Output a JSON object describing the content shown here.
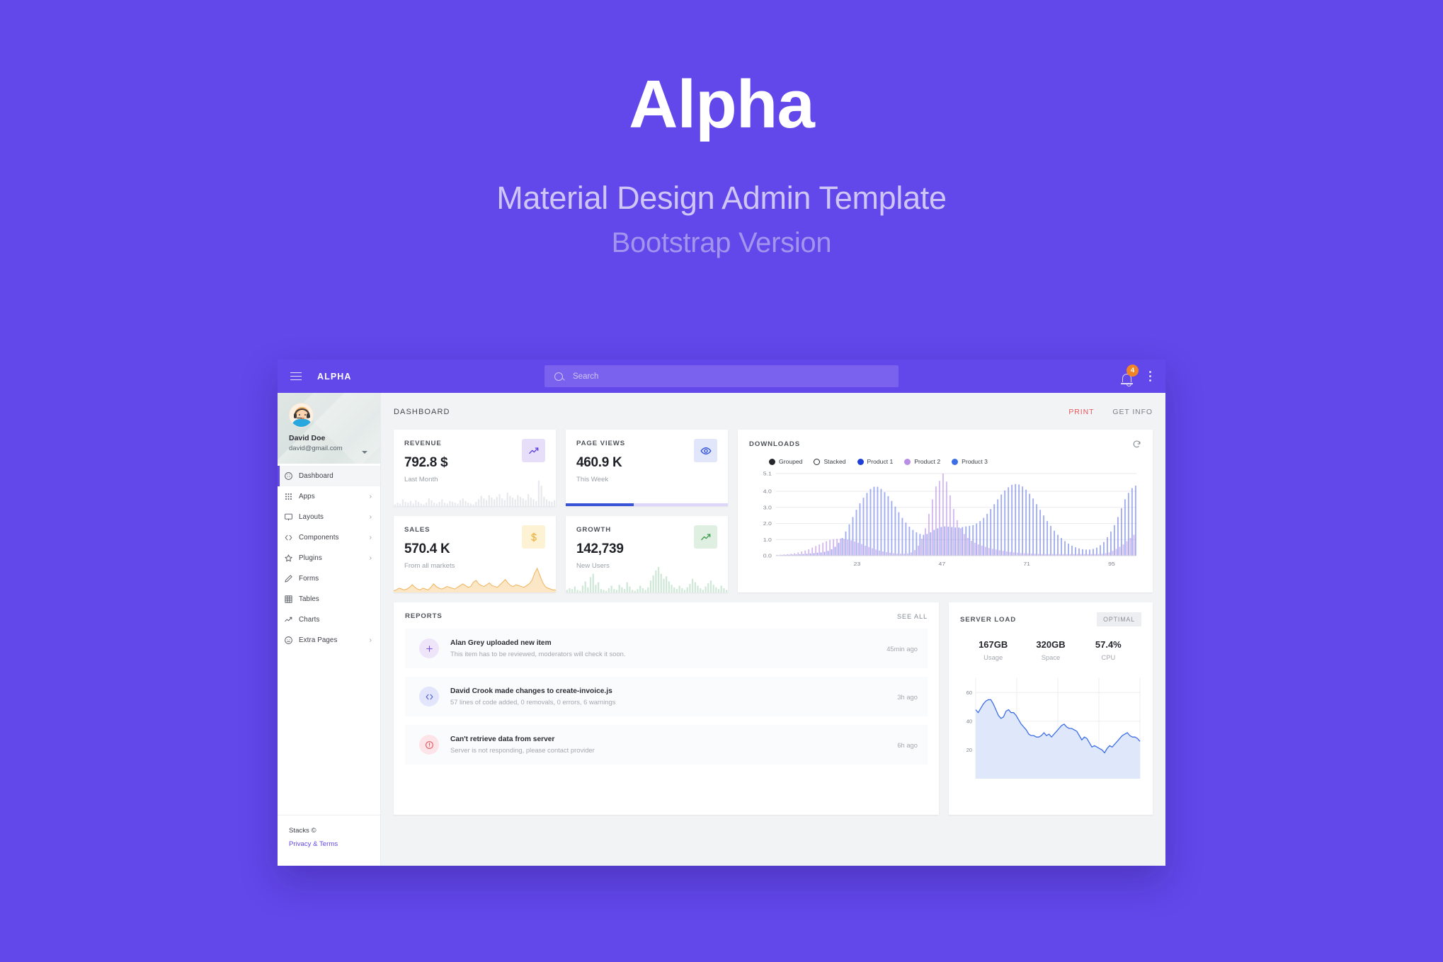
{
  "hero": {
    "title": "Alpha",
    "subtitle": "Material Design Admin Template",
    "subtitle2": "Bootstrap Version"
  },
  "colors": {
    "brand_purple": "#6247ea",
    "accent_blue": "#3853d6",
    "accent_orange": "#f08427",
    "accent_red": "#e2575d",
    "accent_green": "#4caf50",
    "product2_purple": "#b98fe6",
    "product3_blue": "#6b7ce8"
  },
  "topbar": {
    "brand": "ALPHA",
    "menu_icon": "hamburger-icon",
    "search_placeholder": "Search",
    "search_value": "",
    "notification_count": "4",
    "more_icon": "kebab-menu-icon"
  },
  "sidebar": {
    "user": {
      "name": "David Doe",
      "email": "david@gmail.com"
    },
    "items": [
      {
        "label": "Dashboard",
        "icon": "dashboard-icon",
        "chevron": "",
        "active": true
      },
      {
        "label": "Apps",
        "icon": "apps-grid-icon",
        "chevron": "›",
        "active": false
      },
      {
        "label": "Layouts",
        "icon": "monitor-icon",
        "chevron": "›",
        "active": false
      },
      {
        "label": "Components",
        "icon": "code-icon",
        "chevron": "›",
        "active": false
      },
      {
        "label": "Plugins",
        "icon": "star-icon",
        "chevron": "›",
        "active": false
      },
      {
        "label": "Forms",
        "icon": "pencil-icon",
        "chevron": "",
        "active": false
      },
      {
        "label": "Tables",
        "icon": "table-grid-icon",
        "chevron": "",
        "active": false
      },
      {
        "label": "Charts",
        "icon": "trend-line-icon",
        "chevron": "",
        "active": false
      },
      {
        "label": "Extra Pages",
        "icon": "smiley-icon",
        "chevron": "›",
        "active": false
      }
    ],
    "footer": {
      "copyright": "Stacks ©",
      "privacy": "Privacy & Terms"
    }
  },
  "main": {
    "page_title": "DASHBOARD",
    "print_label": "PRINT",
    "get_info_label": "GET INFO"
  },
  "stats": [
    {
      "title": "REVENUE",
      "value": "792.8 $",
      "sub": "Last Month",
      "icon": "trend-up-icon"
    },
    {
      "title": "PAGE VIEWS",
      "value": "460.9 K",
      "sub": "This Week",
      "icon": "eye-icon"
    },
    {
      "title": "SALES",
      "value": "570.4 K",
      "sub": "From all markets",
      "icon": "dollar-icon"
    },
    {
      "title": "GROWTH",
      "value": "142,739",
      "sub": "New Users",
      "icon": "trend-up-icon"
    }
  ],
  "page_views_progress": 42,
  "downloads": {
    "title": "DOWNLOADS",
    "refresh_icon": "refresh-icon",
    "legend": [
      {
        "label": "Grouped",
        "style": "filled-dark"
      },
      {
        "label": "Stacked",
        "style": "hollow"
      },
      {
        "label": "Product 1",
        "style": "filled",
        "color": "#1f3fd6"
      },
      {
        "label": "Product 2",
        "style": "filled",
        "color": "#b98fe6"
      },
      {
        "label": "Product 3",
        "style": "filled",
        "color": "#3d6ee8"
      }
    ]
  },
  "reports": {
    "title": "REPORTS",
    "see_all": "SEE ALL",
    "items": [
      {
        "icon": "plus-icon",
        "title": "Alan Grey uploaded new item",
        "desc": "This item has to be reviewed, moderators will check it soon.",
        "time": "45min ago"
      },
      {
        "icon": "code-icon",
        "title": "David Crook made changes to create-invoice.js",
        "desc": "57 lines of code added, 0 removals, 0 errors, 6 warnings",
        "time": "3h ago"
      },
      {
        "icon": "alert-icon",
        "title": "Can't retrieve data from server",
        "desc": "Server is not responding, please contact provider",
        "time": "6h ago"
      }
    ]
  },
  "server_load": {
    "title": "SERVER LOAD",
    "status": "OPTIMAL",
    "metrics": [
      {
        "value": "167GB",
        "label": "Usage"
      },
      {
        "value": "320GB",
        "label": "Space"
      },
      {
        "value": "57.4%",
        "label": "CPU"
      }
    ]
  },
  "chart_data": [
    {
      "type": "bar",
      "title": "DOWNLOADS",
      "xlabel": "",
      "ylabel": "",
      "ylim": [
        0,
        5.1
      ],
      "yticks": [
        "0.0",
        "1.0",
        "2.0",
        "3.0",
        "4.0",
        "5.1"
      ],
      "xticks": [
        "23",
        "47",
        "71",
        "95"
      ],
      "grid": true,
      "legend": [
        "Grouped",
        "Stacked",
        "Product 1",
        "Product 2",
        "Product 3"
      ],
      "series": [
        {
          "name": "Product 2",
          "color": "#b98fe6",
          "values": [
            0.05,
            0.06,
            0.08,
            0.09,
            0.12,
            0.15,
            0.2,
            0.26,
            0.32,
            0.4,
            0.5,
            0.6,
            0.7,
            0.8,
            0.9,
            0.98,
            1.02,
            1.05,
            1.06,
            1.04,
            1.0,
            0.95,
            0.88,
            0.8,
            0.72,
            0.62,
            0.54,
            0.46,
            0.38,
            0.32,
            0.26,
            0.22,
            0.18,
            0.15,
            0.13,
            0.12,
            0.12,
            0.14,
            0.2,
            0.35,
            0.62,
            1.05,
            1.7,
            2.6,
            3.5,
            4.3,
            4.65,
            5.1,
            4.6,
            3.75,
            2.9,
            2.2,
            1.7,
            1.35,
            1.1,
            0.92,
            0.8,
            0.7,
            0.62,
            0.55,
            0.48,
            0.42,
            0.38,
            0.33,
            0.3,
            0.26,
            0.23,
            0.2,
            0.18,
            0.16,
            0.15,
            0.14,
            0.13,
            0.12,
            0.11,
            0.1,
            0.1,
            0.1,
            0.1,
            0.1,
            0.1,
            0.1,
            0.1,
            0.1,
            0.1,
            0.1,
            0.1,
            0.1,
            0.1,
            0.1,
            0.1,
            0.1,
            0.12,
            0.15,
            0.2,
            0.3,
            0.42,
            0.55,
            0.7,
            0.9,
            1.1,
            1.3
          ]
        },
        {
          "name": "Product 3",
          "color": "#6b7ce8",
          "values": [
            0.03,
            0.04,
            0.05,
            0.06,
            0.07,
            0.08,
            0.09,
            0.1,
            0.12,
            0.14,
            0.16,
            0.18,
            0.2,
            0.24,
            0.3,
            0.4,
            0.55,
            0.8,
            1.1,
            1.5,
            1.95,
            2.4,
            2.85,
            3.25,
            3.6,
            3.9,
            4.15,
            4.28,
            4.28,
            4.15,
            3.95,
            3.7,
            3.4,
            3.05,
            2.7,
            2.35,
            2.05,
            1.8,
            1.6,
            1.45,
            1.35,
            1.3,
            1.35,
            1.45,
            1.6,
            1.7,
            1.78,
            1.82,
            1.8,
            1.78,
            1.75,
            1.75,
            1.78,
            1.82,
            1.85,
            1.9,
            2.0,
            2.15,
            2.35,
            2.6,
            2.9,
            3.2,
            3.5,
            3.8,
            4.05,
            4.25,
            4.4,
            4.45,
            4.42,
            4.3,
            4.1,
            3.85,
            3.55,
            3.2,
            2.85,
            2.5,
            2.15,
            1.85,
            1.55,
            1.3,
            1.1,
            0.9,
            0.75,
            0.62,
            0.52,
            0.45,
            0.4,
            0.38,
            0.38,
            0.42,
            0.5,
            0.65,
            0.85,
            1.15,
            1.5,
            1.9,
            2.4,
            2.95,
            3.5,
            3.9,
            4.2,
            4.35
          ]
        }
      ]
    },
    {
      "type": "area",
      "title": "SERVER LOAD",
      "ylim": [
        0,
        70
      ],
      "yticks": [
        "20",
        "40",
        "60"
      ],
      "grid": true,
      "line_color": "#3d6ee8",
      "fill_color": "#dfe7fb",
      "values": [
        48,
        46,
        49,
        52,
        54,
        55,
        55,
        52,
        48,
        44,
        42,
        43,
        47,
        48,
        46,
        46,
        44,
        41,
        38,
        36,
        34,
        31,
        30,
        30,
        29,
        29,
        30,
        32,
        30,
        31,
        29,
        31,
        33,
        35,
        37,
        38,
        36,
        35,
        35,
        34,
        33,
        30,
        27,
        29,
        28,
        25,
        22,
        23,
        22,
        21,
        20,
        18,
        21,
        23,
        22,
        24,
        26,
        28,
        30,
        31,
        32,
        30,
        29,
        29,
        28,
        26
      ]
    },
    {
      "type": "bar",
      "title": "REVENUE sparkline",
      "color": "#e8e9ec",
      "values": [
        2,
        4,
        3,
        8,
        5,
        4,
        6,
        3,
        7,
        5,
        3,
        2,
        4,
        9,
        7,
        4,
        3,
        5,
        8,
        4,
        3,
        6,
        5,
        4,
        3,
        7,
        9,
        6,
        4,
        3,
        2,
        5,
        8,
        12,
        9,
        7,
        13,
        10,
        8,
        11,
        14,
        9,
        7,
        16,
        12,
        10,
        8,
        13,
        11,
        9,
        7,
        14,
        10,
        8,
        6,
        30,
        24,
        11,
        8,
        6,
        5,
        7
      ]
    },
    {
      "type": "area",
      "title": "SALES sparkline",
      "line_color": "#f0b35a",
      "fill_color": "#fbe6c6",
      "values": [
        2,
        3,
        5,
        4,
        3,
        4,
        6,
        9,
        6,
        4,
        3,
        5,
        4,
        3,
        6,
        10,
        7,
        5,
        4,
        5,
        7,
        6,
        5,
        4,
        6,
        8,
        10,
        8,
        6,
        7,
        12,
        14,
        10,
        8,
        7,
        9,
        11,
        8,
        7,
        6,
        9,
        12,
        15,
        11,
        8,
        7,
        9,
        8,
        7,
        6,
        8,
        10,
        14,
        22,
        28,
        20,
        12,
        7,
        5,
        4,
        3,
        3
      ]
    },
    {
      "type": "bar",
      "title": "GROWTH sparkline",
      "color": "#cfe8d8",
      "values": [
        3,
        5,
        4,
        7,
        3,
        2,
        8,
        13,
        6,
        18,
        22,
        9,
        12,
        4,
        3,
        2,
        5,
        8,
        4,
        3,
        9,
        6,
        4,
        12,
        7,
        3,
        2,
        4,
        8,
        5,
        3,
        6,
        14,
        20,
        26,
        30,
        22,
        16,
        19,
        13,
        9,
        6,
        4,
        8,
        5,
        3,
        6,
        10,
        16,
        12,
        8,
        5,
        3,
        7,
        11,
        14,
        9,
        6,
        4,
        8,
        5,
        3
      ]
    }
  ]
}
